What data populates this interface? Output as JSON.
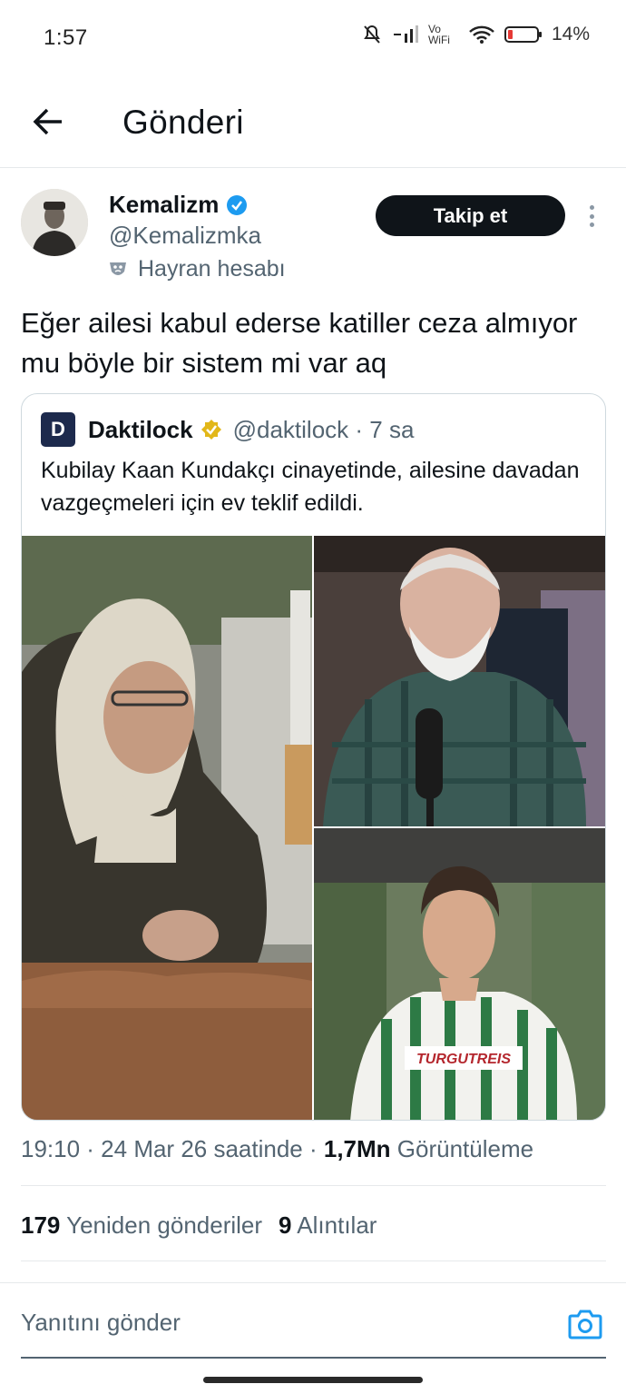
{
  "status_bar": {
    "time": "1:57",
    "battery": "14%",
    "network_label": "Vo WiFi"
  },
  "header": {
    "title": "Gönderi",
    "back_icon": "arrow-left-icon"
  },
  "author": {
    "name": "Kemalizm",
    "verified_color": "#1d9bf0",
    "handle": "@Kemalizmka",
    "label": "Hayran hesabı",
    "label_icon": "theater-mask-icon"
  },
  "follow_button": {
    "label": "Takip et"
  },
  "tweet": {
    "text": "Eğer ailesi kabul ederse katiller ceza almıyor mu böyle bir sistem mi var aq"
  },
  "quote": {
    "logo_letter": "D",
    "name": "Daktilock",
    "verified_color": "#e2b719",
    "handle": "@daktilock · 7 sa",
    "text": "Kubilay Kaan Kundakçı cinayetinde, ailesine davadan vazgeçmeleri için ev teklif edildi.",
    "sponsor_text": "TURGUTREIS"
  },
  "meta": {
    "time": "19:10 · 24 Mar 26 saatinde · ",
    "views_count": "1,7Mn",
    "views_label": " Görüntüleme"
  },
  "stats": {
    "reposts_count": "179",
    "reposts_label": " Yeniden gönderiler",
    "quotes_count": "9",
    "quotes_label": " Alıntılar"
  },
  "reply": {
    "placeholder": "Yanıtını gönder",
    "camera_icon": "camera-icon"
  },
  "colors": {
    "accent": "#1d9bf0",
    "text": "#0f1419",
    "secondary": "#536471",
    "button": "#0f1419"
  }
}
